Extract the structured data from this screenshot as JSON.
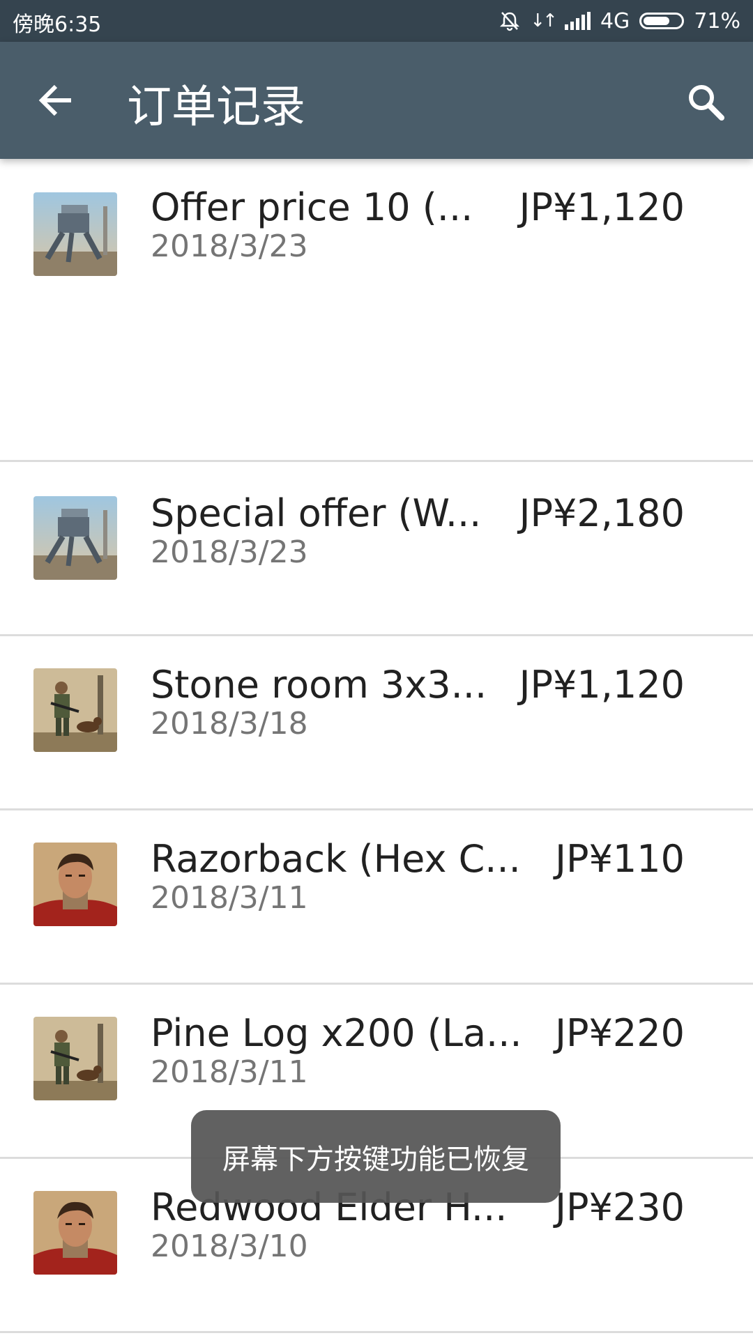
{
  "status_bar": {
    "time": "傍晚6:35",
    "network": "4G",
    "battery": "71%",
    "battery_level": 0.71
  },
  "app_bar": {
    "title": "订单记录",
    "back_icon": "arrow-left-icon",
    "search_icon": "search-icon"
  },
  "orders": [
    {
      "title": "Offer price 10 (...",
      "date": "2018/3/23",
      "price": "JP¥1,120",
      "icon": "mech-robot-game-icon"
    },
    {
      "title": "Special offer (W...",
      "date": "2018/3/23",
      "price": "JP¥2,180",
      "icon": "mech-robot-game-icon"
    },
    {
      "title": "Stone room 3x3...",
      "date": "2018/3/18",
      "price": "JP¥1,120",
      "icon": "soldier-dog-game-icon"
    },
    {
      "title": "Razorback (Hex C...",
      "date": "2018/3/11",
      "price": "JP¥110",
      "icon": "warrior-portrait-game-icon"
    },
    {
      "title": "Pine Log x200 (La...",
      "date": "2018/3/11",
      "price": "JP¥220",
      "icon": "soldier-dog-game-icon"
    },
    {
      "title": "Redwood Elder H...",
      "date": "2018/3/10",
      "price": "JP¥230",
      "icon": "warrior-portrait-game-icon"
    }
  ],
  "toast": {
    "message": "屏幕下方按键功能已恢复"
  },
  "colors": {
    "status_bar": "#35444f",
    "app_bar": "#4a5d6a",
    "divider": "#dcdcdc"
  }
}
